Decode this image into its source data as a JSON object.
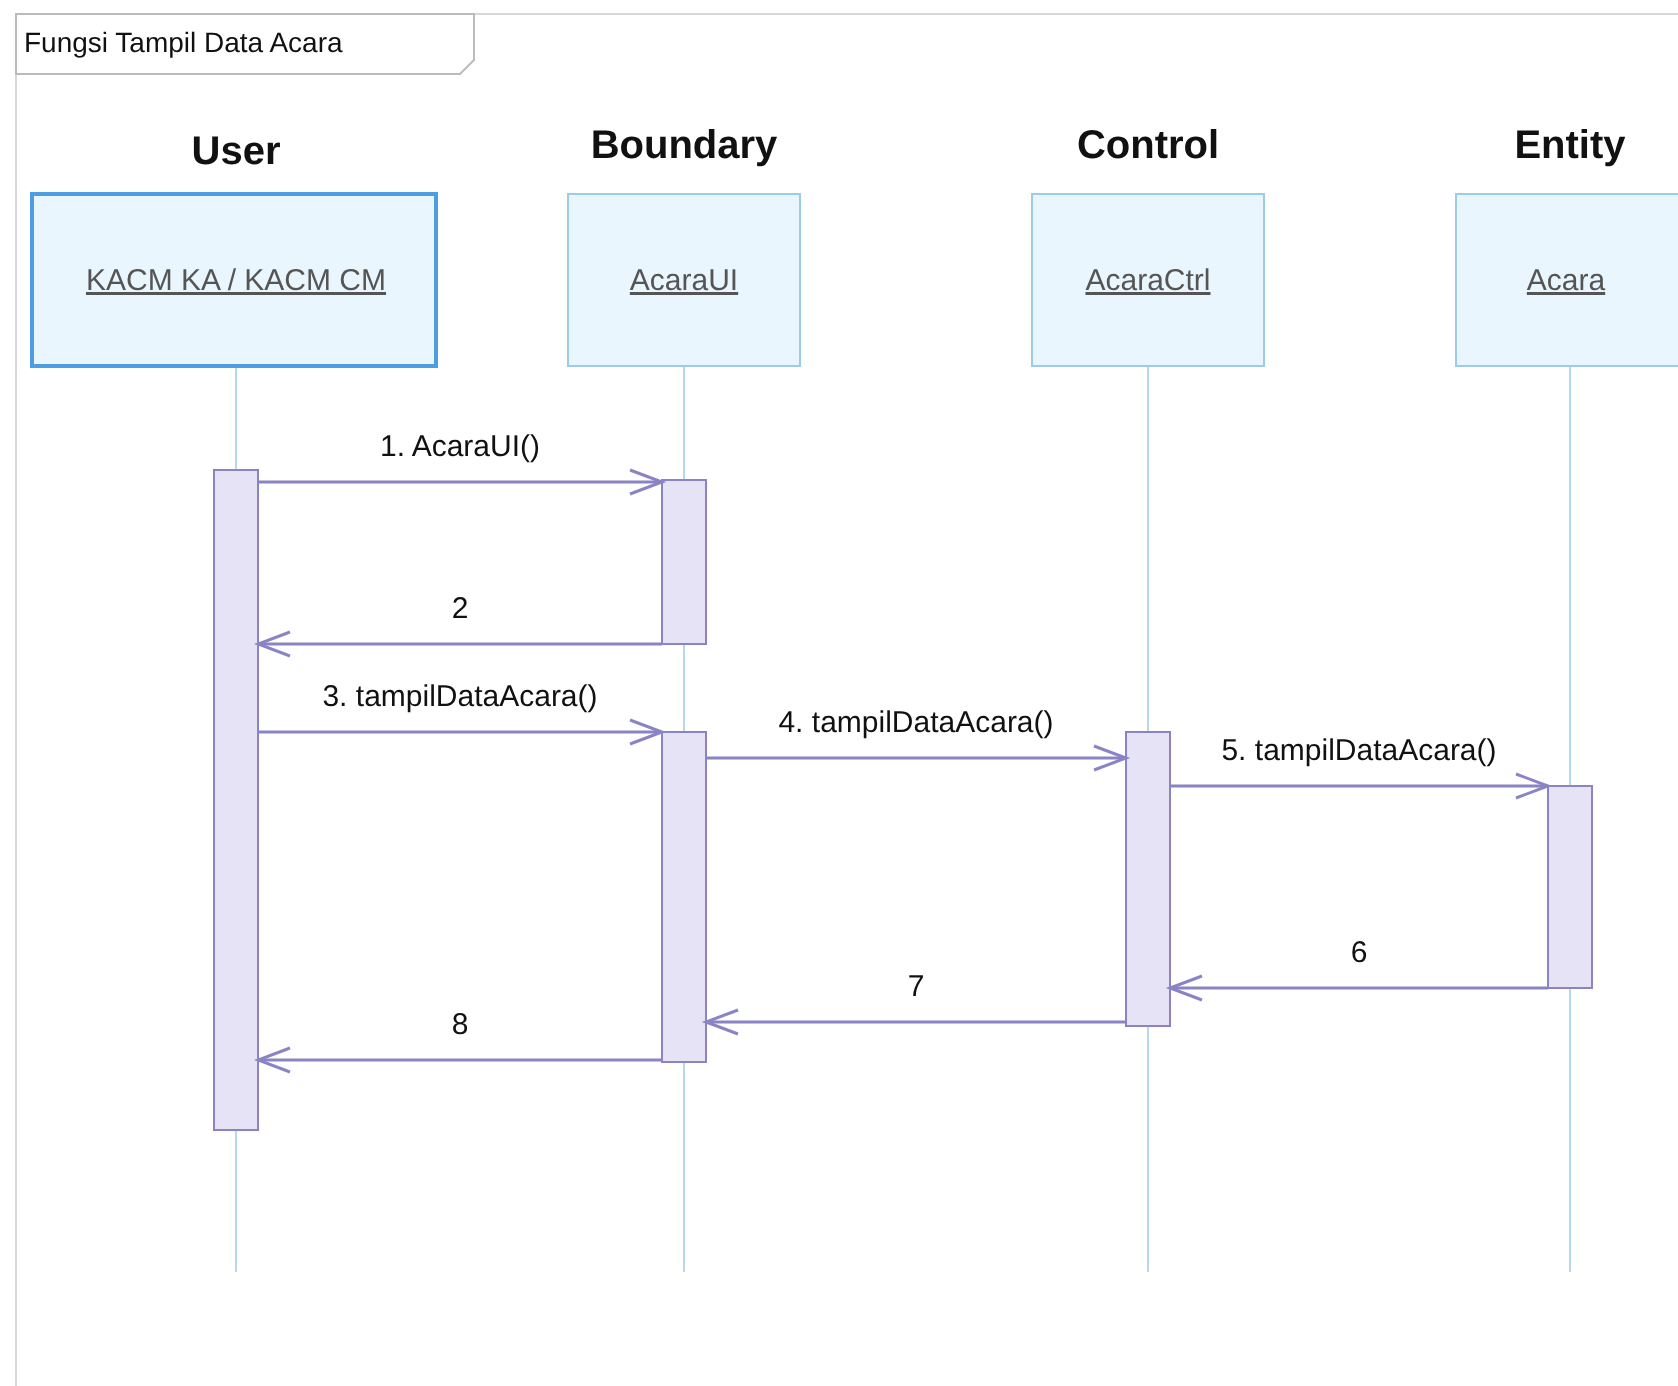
{
  "diagram": {
    "title": "Fungsi Tampil Data Acara"
  },
  "lifelines": [
    {
      "header": "User",
      "name": "KACM KA / KACM CM"
    },
    {
      "header": "Boundary",
      "name": "AcaraUI"
    },
    {
      "header": "Control",
      "name": "AcaraCtrl"
    },
    {
      "header": "Entity",
      "name": "Acara"
    }
  ],
  "messages": [
    {
      "label": "1. AcaraUI()"
    },
    {
      "label": "2"
    },
    {
      "label": "3. tampilDataAcara()"
    },
    {
      "label": "4. tampilDataAcara()"
    },
    {
      "label": "5. tampilDataAcara()"
    },
    {
      "label": "6"
    },
    {
      "label": "7"
    },
    {
      "label": "8"
    }
  ]
}
